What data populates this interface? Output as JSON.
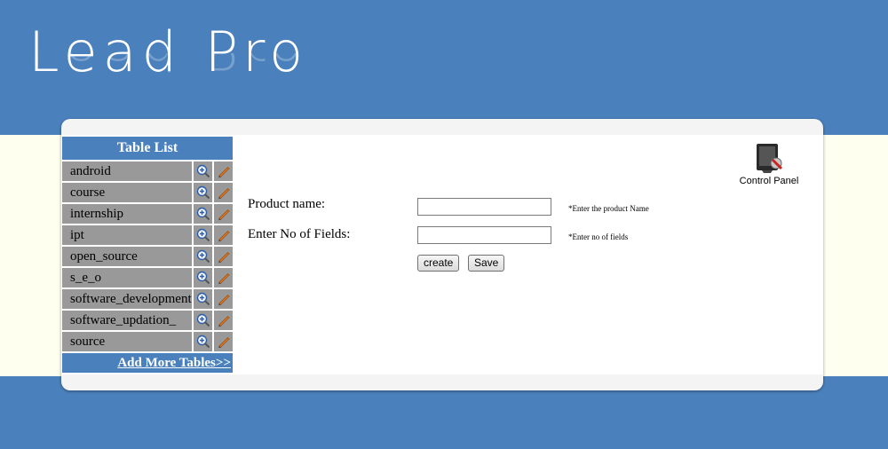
{
  "app": {
    "logo_text": "Lead Pro"
  },
  "table_list": {
    "header": "Table List",
    "items": [
      {
        "label": "android"
      },
      {
        "label": "course"
      },
      {
        "label": "internship"
      },
      {
        "label": "ipt"
      },
      {
        "label": "open_source"
      },
      {
        "label": "s_e_o"
      },
      {
        "label": "software_development"
      },
      {
        "label": "software_updation_"
      },
      {
        "label": "source"
      }
    ],
    "item_actions": [
      "zoom-in-icon",
      "pencil-icon"
    ],
    "add_more_link": "Add More Tables>>"
  },
  "control_panel": {
    "label": "Control Panel",
    "icon": "control-panel-icon"
  },
  "form": {
    "product_name_label": "Product name:",
    "product_name_value": "",
    "product_name_hint": "*Enter the product Name",
    "fields_label": "Enter No of Fields:",
    "fields_value": "",
    "fields_hint": "*Enter no of fields",
    "create_button": "create",
    "save_button": "Save"
  },
  "colors": {
    "brand_blue": "#4a80bc",
    "row_gray": "#999999",
    "band_light": "#fffff0"
  }
}
